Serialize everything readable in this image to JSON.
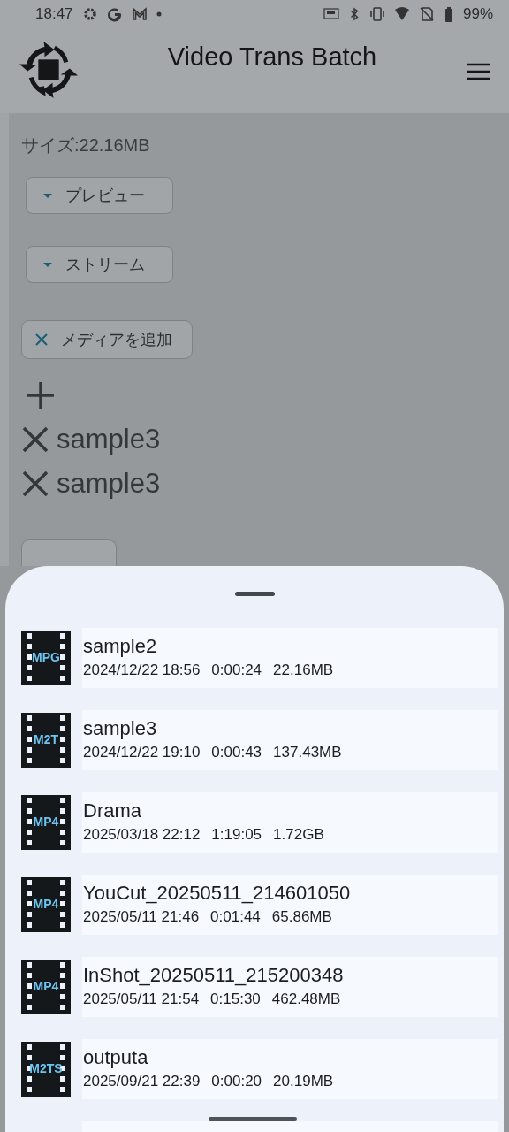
{
  "status_bar": {
    "time": "18:47",
    "battery": "99%"
  },
  "app_bar": {
    "title": "Video Trans Batch"
  },
  "details": {
    "lines": [
      "サイズ:22.16MB"
    ]
  },
  "expanders": [
    {
      "label": "プレビュー",
      "expanded": false
    },
    {
      "label": "ストリーム",
      "expanded": false
    }
  ],
  "add_media_chip": {
    "label": "メディアを追加"
  },
  "media_list": [
    {
      "name": "sample3"
    },
    {
      "name": "sample3"
    }
  ],
  "file_sheet": {
    "files": [
      {
        "type": "MPG",
        "name": "sample2",
        "date": "2024/12/22 18:56",
        "duration": "0:00:24",
        "size": "22.16MB"
      },
      {
        "type": "M2T",
        "name": "sample3",
        "date": "2024/12/22 19:10",
        "duration": "0:00:43",
        "size": "137.43MB"
      },
      {
        "type": "MP4",
        "name": "Drama",
        "date": "2025/03/18 22:12",
        "duration": "1:19:05",
        "size": "1.72GB"
      },
      {
        "type": "MP4",
        "name": "YouCut_20250511_214601050",
        "date": "2025/05/11 21:46",
        "duration": "0:01:44",
        "size": "65.86MB"
      },
      {
        "type": "MP4",
        "name": "InShot_20250511_215200348",
        "date": "2025/05/11 21:54",
        "duration": "0:15:30",
        "size": "462.48MB"
      },
      {
        "type": "M2TS",
        "name": "outputa",
        "date": "2025/09/21 22:39",
        "duration": "0:00:20",
        "size": "20.19MB"
      }
    ]
  }
}
